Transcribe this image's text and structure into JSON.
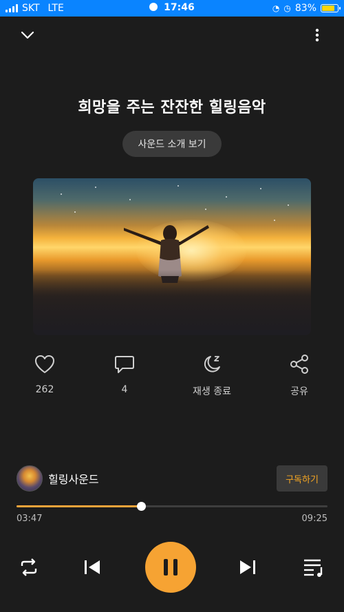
{
  "status_bar": {
    "carrier": "SKT",
    "network": "LTE",
    "time": "17:46",
    "battery": "83%",
    "battery_level": 0.83
  },
  "header": {
    "collapse_icon": "chevron-down-icon",
    "more_icon": "more-vertical-icon"
  },
  "title": "희망을 주는 잔잔한 힐링음악",
  "intro_button": "사운드 소개 보기",
  "actions": [
    {
      "icon": "heart-icon",
      "label": "262"
    },
    {
      "icon": "comment-icon",
      "label": "4"
    },
    {
      "icon": "sleep-timer-icon",
      "label": "재생 종료"
    },
    {
      "icon": "share-icon",
      "label": "공유"
    }
  ],
  "channel": {
    "name": "힐링사운드",
    "subscribe_label": "구독하기"
  },
  "player": {
    "elapsed": "03:47",
    "duration": "09:25",
    "progress": 0.4
  },
  "controls": {
    "repeat_icon": "repeat-icon",
    "prev_icon": "skip-previous-icon",
    "pause_icon": "pause-icon",
    "next_icon": "skip-next-icon",
    "playlist_icon": "playlist-icon"
  },
  "colors": {
    "accent": "#f6a333",
    "background": "#1c1c1c",
    "status_bar": "#0a84ff"
  }
}
